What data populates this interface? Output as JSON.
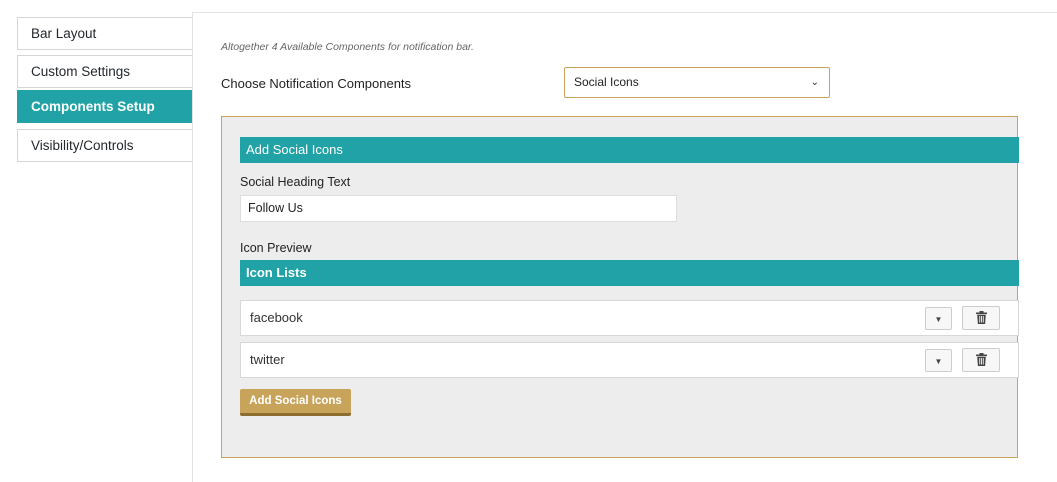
{
  "sidebar": {
    "tabs": [
      {
        "label": "Bar Layout"
      },
      {
        "label": "Custom Settings"
      },
      {
        "label": "Components Setup"
      },
      {
        "label": "Visibility/Controls"
      }
    ],
    "active_tab": "Components Setup"
  },
  "main": {
    "note": "Altogether 4 Available Components for notification bar.",
    "choose_label": "Choose Notification Components",
    "select": {
      "value": "Social Icons",
      "icon": "chevron-down-icon"
    }
  },
  "panel": {
    "header": "Add Social Icons",
    "heading_label": "Social Heading Text",
    "heading_value": "Follow Us",
    "preview_label": "Icon Preview",
    "list_header": "Icon Lists",
    "icons": [
      {
        "name": "facebook"
      },
      {
        "name": "twitter"
      }
    ],
    "add_button": "Add Social Icons"
  },
  "colors": {
    "accent_teal": "#21a2a6",
    "gold_border": "#c8a35a",
    "panel_bg": "#ededed"
  }
}
